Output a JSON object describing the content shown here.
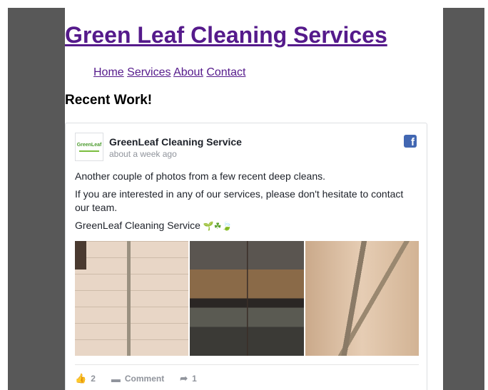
{
  "site": {
    "title": "Green Leaf Cleaning Services",
    "nav": [
      "Home",
      "Services",
      "About",
      "Contact"
    ],
    "section_heading": "Recent Work!"
  },
  "post": {
    "logo_text": "GreenLeaf",
    "page_name": "GreenLeaf Cleaning Service",
    "timestamp": "about a week ago",
    "paragraphs": [
      "Another couple of photos from a few recent deep cleans.",
      "If you are interested in any of our services, please don't hesitate to contact our team."
    ],
    "signature": "GreenLeaf Cleaning Service",
    "signature_emoji": "🌱☘🍃",
    "photos": [
      "shower-photo",
      "oven-photo",
      "floor-corner-photo"
    ],
    "actions": {
      "likes": "2",
      "comment_label": "Comment",
      "shares": "1"
    }
  },
  "colors": {
    "link": "#551a8b",
    "frame": "#585858",
    "facebook": "#4267b2"
  }
}
